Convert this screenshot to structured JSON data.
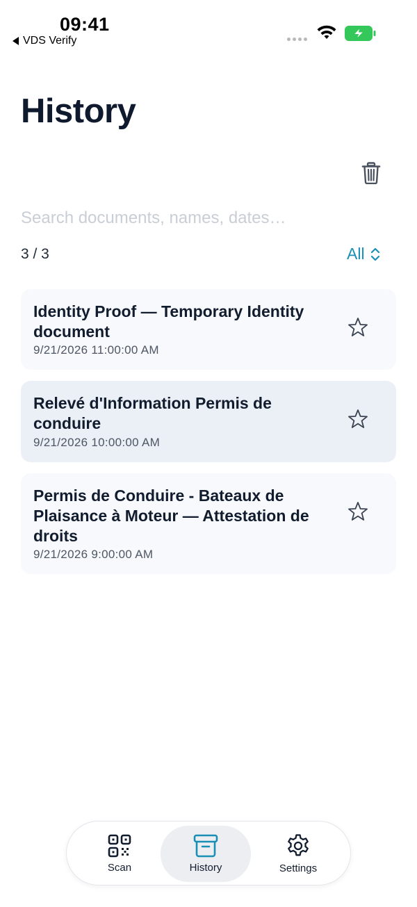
{
  "status_bar": {
    "time": "09:41",
    "back_app": "VDS Verify"
  },
  "header": {
    "title": "History"
  },
  "search": {
    "placeholder": "Search documents, names, dates…",
    "value": ""
  },
  "list_meta": {
    "count": "3 / 3",
    "filter_label": "All"
  },
  "documents": [
    {
      "title": "Identity Proof — Temporary Identity document",
      "date": "9/21/2026 11:00:00 AM",
      "starred": false
    },
    {
      "title": "Relevé d'Information Permis de conduire",
      "date": "9/21/2026 10:00:00 AM",
      "starred": false
    },
    {
      "title": "Permis de Conduire - Bateaux de Plaisance à Moteur — Attestation de droits",
      "date": "9/21/2026 9:00:00 AM",
      "starred": false
    }
  ],
  "tabs": [
    {
      "label": "Scan",
      "icon": "qr-code-icon"
    },
    {
      "label": "History",
      "icon": "archive-box-icon"
    },
    {
      "label": "Settings",
      "icon": "gear-icon"
    }
  ],
  "colors": {
    "accent": "#1a8fb5",
    "battery": "#34c759",
    "text_primary": "#0f1a2e"
  }
}
